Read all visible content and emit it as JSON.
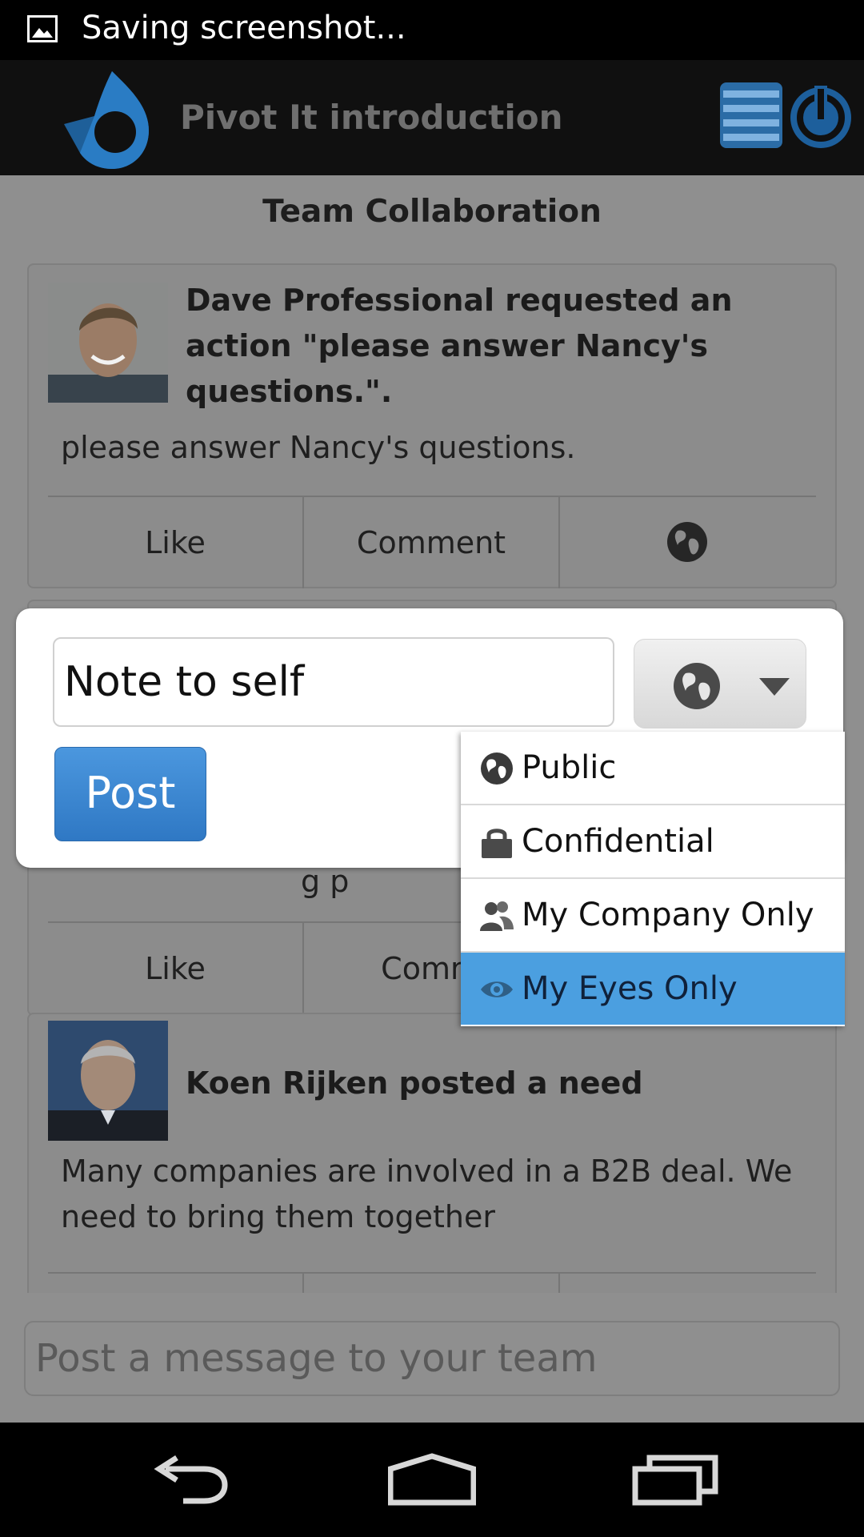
{
  "status_bar": {
    "text": "Saving screenshot..."
  },
  "app_bar": {
    "title": "Pivot It introduction"
  },
  "feed": {
    "section_title": "Team Collaboration",
    "cards": [
      {
        "headline_lines": [
          "Dave Professional requested an",
          "action \"please answer Nancy's",
          "questions.\"."
        ],
        "body_lines": [
          "please answer Nancy's questions."
        ],
        "like": "Like",
        "comment": "Comment"
      },
      {
        "like": "Like",
        "comment_partial": "Comm"
      },
      {
        "headline_lines": [
          "Koen Rijken posted a need"
        ],
        "body_lines": [
          "Many companies are involved in a B2B deal. We",
          "need to bring them together"
        ]
      }
    ]
  },
  "composer": {
    "input_value": "Note to self",
    "post_label": "Post",
    "visibility": {
      "options": [
        {
          "label": "Public",
          "icon": "globe-icon"
        },
        {
          "label": "Confidential",
          "icon": "lock-icon"
        },
        {
          "label": "My Company Only",
          "icon": "people-icon"
        },
        {
          "label": "My Eyes Only",
          "icon": "eye-icon"
        }
      ],
      "selected": "My Eyes Only"
    }
  },
  "compose_bar": {
    "placeholder": "Post a message to your team"
  },
  "colors": {
    "accent": "#4b9fe0",
    "post_button": "#3a86d2",
    "logo": "#1e73b8"
  }
}
